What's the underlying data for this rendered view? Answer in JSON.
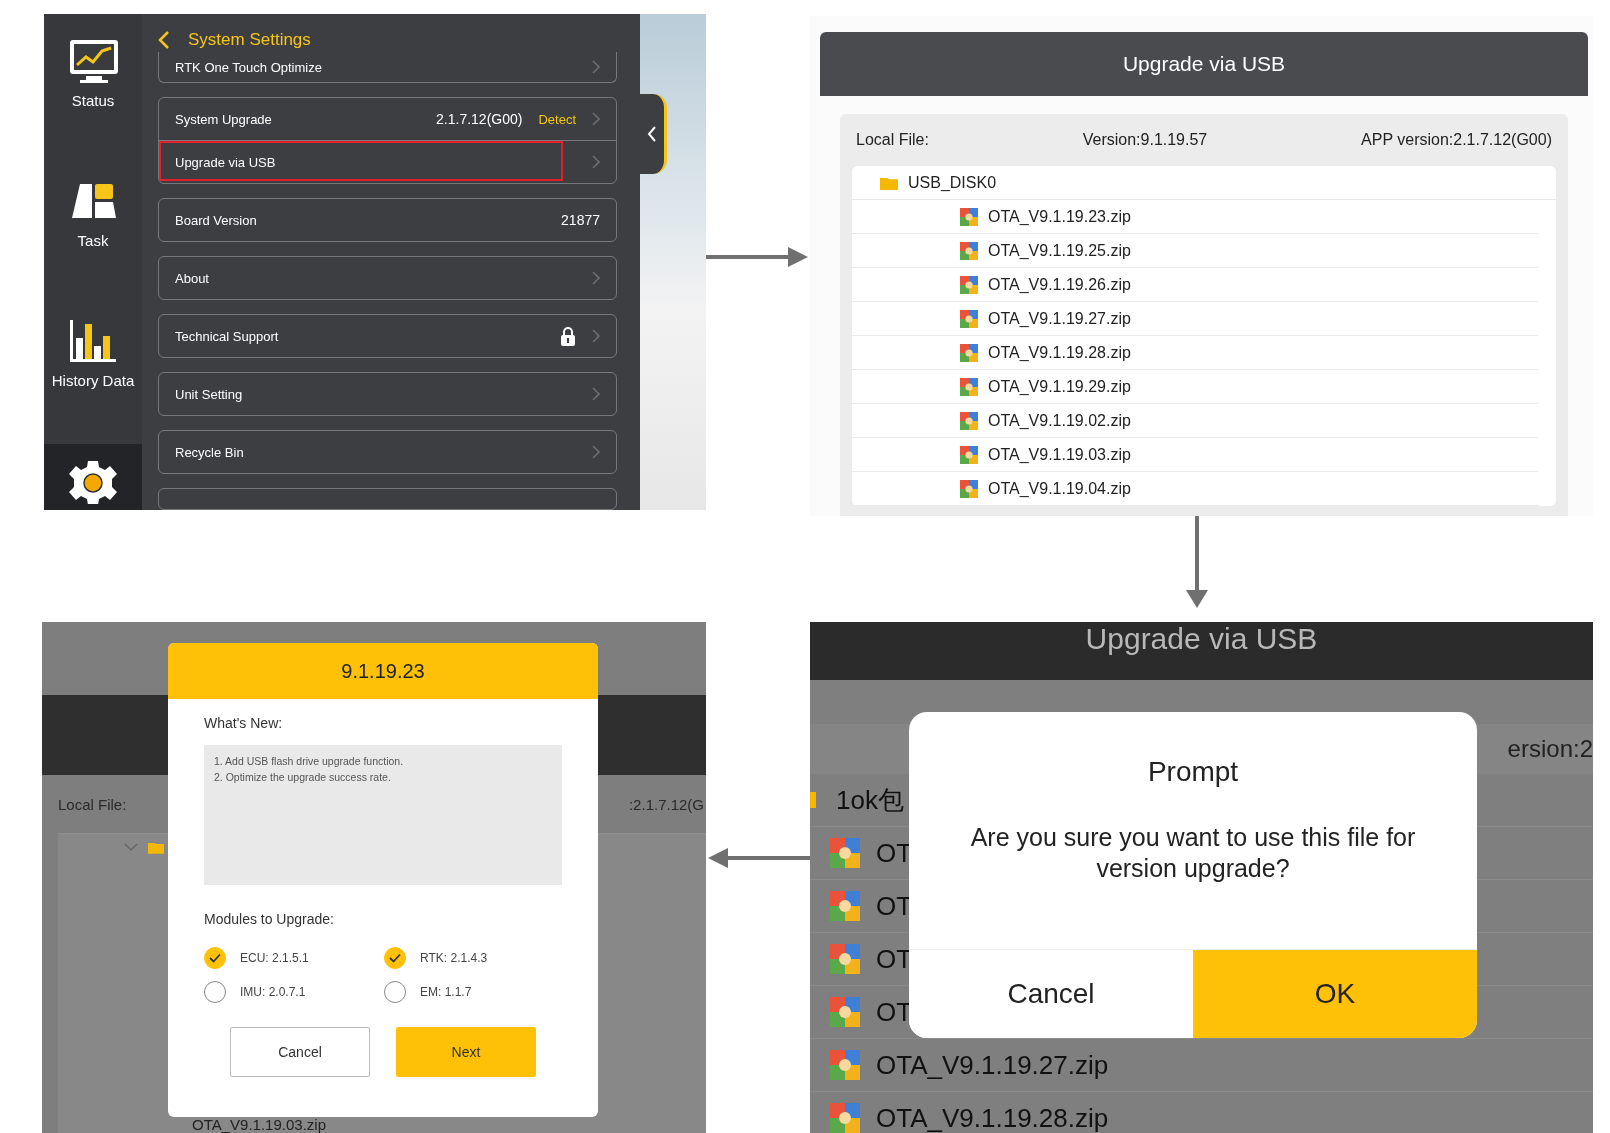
{
  "settings_screen": {
    "sidebar": {
      "items": [
        {
          "kind": "status",
          "label": "Status",
          "selected": false
        },
        {
          "kind": "task",
          "label": "Task",
          "selected": false
        },
        {
          "kind": "history",
          "label": "History Data",
          "selected": false
        },
        {
          "kind": "settings",
          "selected": true
        }
      ]
    },
    "title": "System Settings",
    "groups": [
      {
        "rows": [
          {
            "label": "RTK One Touch Optimize",
            "chevron": true,
            "locked": false,
            "highlighted": false
          }
        ]
      },
      {
        "rows": [
          {
            "label": "System Upgrade",
            "value": "2.1.7.12(G00)",
            "action": "Detect",
            "chevron": true,
            "locked": false,
            "highlighted": false
          },
          {
            "label": "Upgrade via USB",
            "chevron": true,
            "locked": false,
            "highlighted": true
          }
        ]
      },
      {
        "rows": [
          {
            "label": "Board Version",
            "value": "21877",
            "chevron": false,
            "locked": false,
            "highlighted": false
          }
        ]
      },
      {
        "rows": [
          {
            "label": "About",
            "chevron": true,
            "locked": false,
            "highlighted": false
          }
        ]
      },
      {
        "rows": [
          {
            "label": "Technical Support",
            "chevron": true,
            "locked": true,
            "highlighted": false
          }
        ]
      },
      {
        "rows": [
          {
            "label": "Unit Setting",
            "chevron": true,
            "locked": false,
            "highlighted": false
          }
        ]
      },
      {
        "rows": [
          {
            "label": "Recycle Bin",
            "chevron": true,
            "locked": false,
            "highlighted": false
          }
        ]
      }
    ]
  },
  "file_browser": {
    "title": "Upgrade via USB",
    "local_file_label": "Local File:",
    "version": "Version:9.1.19.57",
    "app_version": "APP version:2.1.7.12(G00)",
    "folder": {
      "name": "USB_DISK0",
      "children": [
        {
          "name": "OTA_V9.1.19.23.zip"
        },
        {
          "name": "OTA_V9.1.19.25.zip"
        },
        {
          "name": "OTA_V9.1.19.26.zip"
        },
        {
          "name": "OTA_V9.1.19.27.zip"
        },
        {
          "name": "OTA_V9.1.19.28.zip"
        },
        {
          "name": "OTA_V9.1.19.29.zip"
        },
        {
          "name": "OTA_V9.1.19.02.zip"
        },
        {
          "name": "OTA_V9.1.19.03.zip"
        },
        {
          "name": "OTA_V9.1.19.04.zip"
        }
      ]
    }
  },
  "release_dialog_screen": {
    "background": {
      "local_file_label": "Local File:",
      "app_version_fragment": ":2.1.7.12(G",
      "visible_file": "OTA_V9.1.19.03.zip"
    },
    "dialog": {
      "title": "9.1.19.23",
      "whats_new_label": "What's New:",
      "notes": [
        "1. Add USB flash drive upgrade function.",
        "2. Optimize the upgrade success rate."
      ],
      "modules_label": "Modules to Upgrade:",
      "modules": [
        {
          "label": "ECU: 2.1.5.1",
          "checked": true
        },
        {
          "label": "RTK: 2.1.4.3",
          "checked": true
        },
        {
          "label": "IMU: 2.0.7.1",
          "checked": false
        },
        {
          "label": "EM: 1.1.7",
          "checked": false
        }
      ],
      "buttons": [
        {
          "label": "Cancel",
          "kind": "secondary"
        },
        {
          "label": "Next",
          "kind": "primary"
        }
      ]
    }
  },
  "confirm_screen": {
    "background": {
      "title": "Upgrade via USB",
      "version_fragment": "ersion:2",
      "folder": "1ok包",
      "files": [
        "OT",
        "OT",
        "OT",
        "OT",
        "OTA_V9.1.19.27.zip",
        "OTA_V9.1.19.28.zip"
      ]
    },
    "dialog": {
      "title": "Prompt",
      "message": "Are you sure you want to use this file for version upgrade?",
      "buttons": [
        {
          "label": "Cancel",
          "kind": "secondary"
        },
        {
          "label": "OK",
          "kind": "primary"
        }
      ]
    }
  }
}
